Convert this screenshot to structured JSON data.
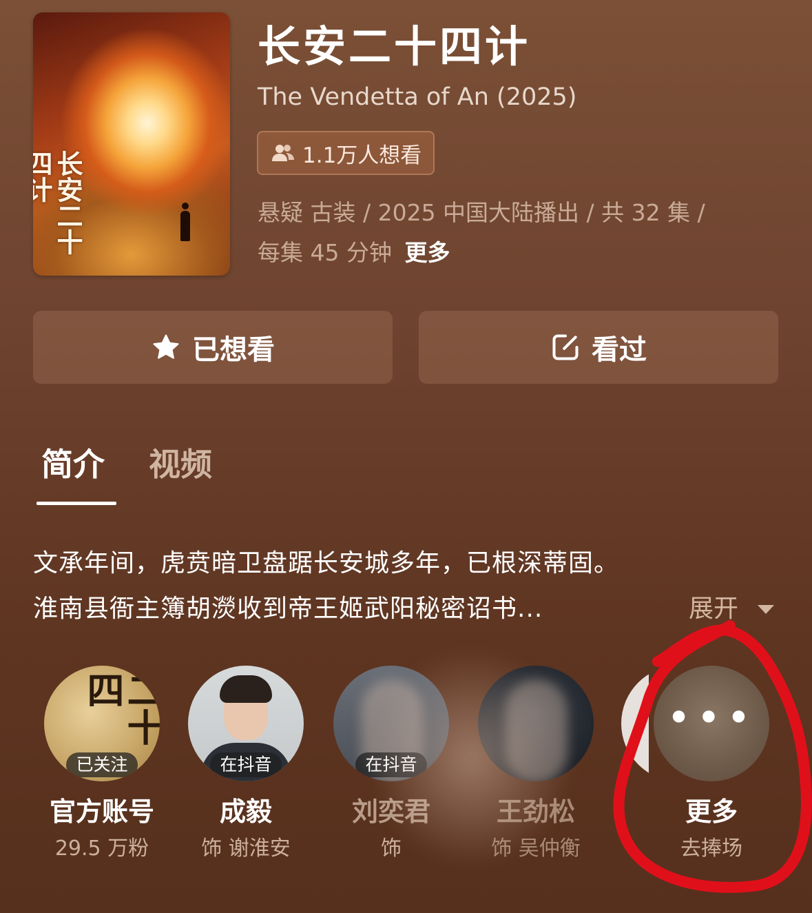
{
  "show": {
    "title": "长安二十四计",
    "subtitle": "The Vendetta of An (2025)",
    "want_count": "1.1万人想看",
    "meta_line1": "悬疑 古装 / 2025 中国大陆播出 / 共 32 集 /",
    "meta_line2": "每集 45 分钟",
    "more_label": "更多",
    "poster_text": "长安二十四计"
  },
  "actions": {
    "want_label": "已想看",
    "seen_label": "看过"
  },
  "tabs": [
    {
      "label": "简介",
      "active": true
    },
    {
      "label": "视频",
      "active": false
    }
  ],
  "synopsis": {
    "line1": "文承年间，虎贲暗卫盘踞长安城多年，已根深蒂固。",
    "line2": "淮南县衙主簿胡濙收到帝王姬武阳秘密诏书...",
    "expand_label": "展开"
  },
  "cast": [
    {
      "name": "官方账号",
      "sub": "29.5 万粉",
      "tag": "已关注",
      "avatar_text": "长安二十四"
    },
    {
      "name": "成毅",
      "sub": "饰 谢淮安",
      "tag": "在抖音"
    },
    {
      "name": "刘奕君",
      "sub": "饰",
      "tag": "在抖音"
    },
    {
      "name": "王劲松",
      "sub": "饰 吴仲衡",
      "tag": ""
    }
  ],
  "cast_more": {
    "label": "更多",
    "sub": "去捧场"
  },
  "colors": {
    "background": "#6e4330",
    "annotation": "#e0101a"
  }
}
